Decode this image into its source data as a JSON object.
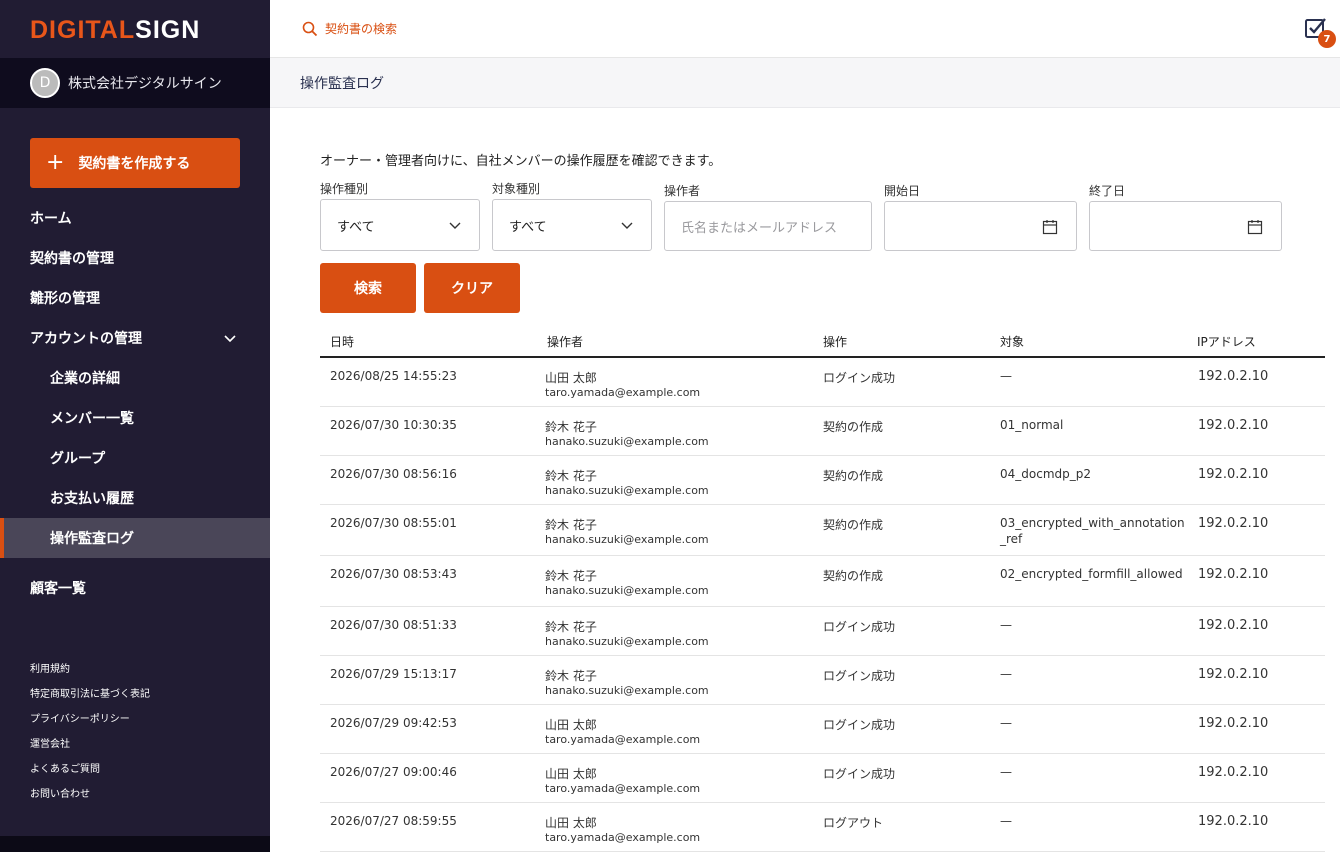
{
  "app": {
    "logo_part1": "DIGITAL",
    "logo_part2": "SIGN",
    "company_initial": "D",
    "company_name": "株式会社デジタルサイン"
  },
  "sidebar": {
    "create_label": "契約書を作成する",
    "nav": [
      {
        "label": "ホーム"
      },
      {
        "label": "契約書の管理"
      },
      {
        "label": "雛形の管理"
      },
      {
        "label": "アカウントの管理"
      },
      {
        "label": "企業の詳細"
      },
      {
        "label": "メンバー一覧"
      },
      {
        "label": "グループ"
      },
      {
        "label": "お支払い履歴"
      },
      {
        "label": "操作監査ログ"
      },
      {
        "label": "顧客一覧"
      }
    ],
    "active_item": "操作監査ログ",
    "footer": [
      "利用規約",
      "特定商取引法に基づく表記",
      "プライバシーポリシー",
      "運営会社",
      "よくあるご質問",
      "お問い合わせ"
    ]
  },
  "header": {
    "search_label": "契約書の検索",
    "task_count": "7",
    "page_title": "操作監査ログ"
  },
  "filters": {
    "intro": "オーナー・管理者向けに、自社メンバーの操作履歴を確認できます。",
    "op_type_label": "操作種別",
    "op_type_value": "すべて",
    "target_type_label": "対象種別",
    "target_type_value": "すべて",
    "operator_label": "操作者",
    "operator_placeholder": "氏名またはメールアドレス",
    "start_label": "開始日",
    "end_label": "終了日",
    "search_button": "検索",
    "clear_button": "クリア"
  },
  "table": {
    "headers": [
      "日時",
      "操作者",
      "操作",
      "対象",
      "IPアドレス"
    ],
    "rows": [
      {
        "datetime": "2026/08/25 14:55:23",
        "name": "山田 太郎",
        "email": "taro.yamada@example.com",
        "action": "ログイン成功",
        "target": "—",
        "ip": "192.0.2.10"
      },
      {
        "datetime": "2026/07/30 10:30:35",
        "name": "鈴木 花子",
        "email": "hanako.suzuki@example.com",
        "action": "契約の作成",
        "target": "01_normal",
        "ip": "192.0.2.10"
      },
      {
        "datetime": "2026/07/30 08:56:16",
        "name": "鈴木 花子",
        "email": "hanako.suzuki@example.com",
        "action": "契約の作成",
        "target": "04_docmdp_p2",
        "ip": "192.0.2.10"
      },
      {
        "datetime": "2026/07/30 08:55:01",
        "name": "鈴木 花子",
        "email": "hanako.suzuki@example.com",
        "action": "契約の作成",
        "target": "03_encrypted_with_annotation_ref",
        "ip": "192.0.2.10"
      },
      {
        "datetime": "2026/07/30 08:53:43",
        "name": "鈴木 花子",
        "email": "hanako.suzuki@example.com",
        "action": "契約の作成",
        "target": "02_encrypted_formfill_allowed",
        "ip": "192.0.2.10"
      },
      {
        "datetime": "2026/07/30 08:51:33",
        "name": "鈴木 花子",
        "email": "hanako.suzuki@example.com",
        "action": "ログイン成功",
        "target": "—",
        "ip": "192.0.2.10"
      },
      {
        "datetime": "2026/07/29 15:13:17",
        "name": "鈴木 花子",
        "email": "hanako.suzuki@example.com",
        "action": "ログイン成功",
        "target": "—",
        "ip": "192.0.2.10"
      },
      {
        "datetime": "2026/07/29 09:42:53",
        "name": "山田 太郎",
        "email": "taro.yamada@example.com",
        "action": "ログイン成功",
        "target": "—",
        "ip": "192.0.2.10"
      },
      {
        "datetime": "2026/07/27 09:00:46",
        "name": "山田 太郎",
        "email": "taro.yamada@example.com",
        "action": "ログイン成功",
        "target": "—",
        "ip": "192.0.2.10"
      },
      {
        "datetime": "2026/07/27 08:59:55",
        "name": "山田 太郎",
        "email": "taro.yamada@example.com",
        "action": "ログアウト",
        "target": "—",
        "ip": "192.0.2.10"
      }
    ]
  },
  "colors": {
    "accent": "#d94f12",
    "sidebar_bg": "#211c33"
  }
}
